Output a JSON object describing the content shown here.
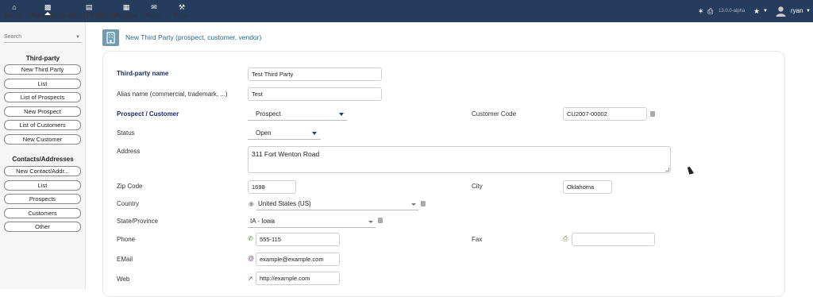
{
  "topbar": {
    "items": [
      {
        "label": "Home",
        "icon": "home-icon"
      },
      {
        "label": "Third-parties",
        "icon": "building-icon"
      },
      {
        "label": "Billing | Payment",
        "icon": "invoice-icon"
      },
      {
        "label": "Agenda",
        "icon": "calendar-icon"
      },
      {
        "label": "Ticket",
        "icon": "envelope-icon"
      },
      {
        "label": "Tools",
        "icon": "wrench-icon"
      }
    ],
    "version": "13.0.0-alpha",
    "user": "ryan",
    "bg_color": "#263c5c"
  },
  "sidebar": {
    "search_placeholder": "Search",
    "section1_title": "Third-party",
    "section1_items": [
      "New Third Party",
      "List",
      "List of Prospects",
      "New Prospect",
      "List of Customers",
      "New Customer"
    ],
    "section2_title": "Contacts/Addresses",
    "section2_items": [
      "New Contact/Addr...",
      "List",
      "Prospects",
      "Customers",
      "Other"
    ]
  },
  "header": {
    "title": "New Third Party (prospect, customer, vendor)"
  },
  "form": {
    "name_label": "Third-party name",
    "name_value": "Test Third Party",
    "alias_label": "Alias name (commercial, trademark, ...)",
    "alias_value": "Test",
    "prospect_label": "Prospect / Customer",
    "prospect_value": "Prospect",
    "customer_code_label": "Customer Code",
    "customer_code_value": "CU2007-00002",
    "status_label": "Status",
    "status_value": "Open",
    "address_label": "Address",
    "address_value": "311 Fort Wenton Road",
    "zip_label": "Zip Code",
    "zip_value": "1698",
    "city_label": "City",
    "city_value": "Oklahoma",
    "country_label": "Country",
    "country_value": "United States (US)",
    "state_label": "State/Province",
    "state_value": "IA - Iowa",
    "phone_label": "Phone",
    "phone_value": "555-115",
    "fax_label": "Fax",
    "fax_value": "",
    "email_label": "EMail",
    "email_value": "example@example.com",
    "web_label": "Web",
    "web_value": "http://example.com"
  }
}
